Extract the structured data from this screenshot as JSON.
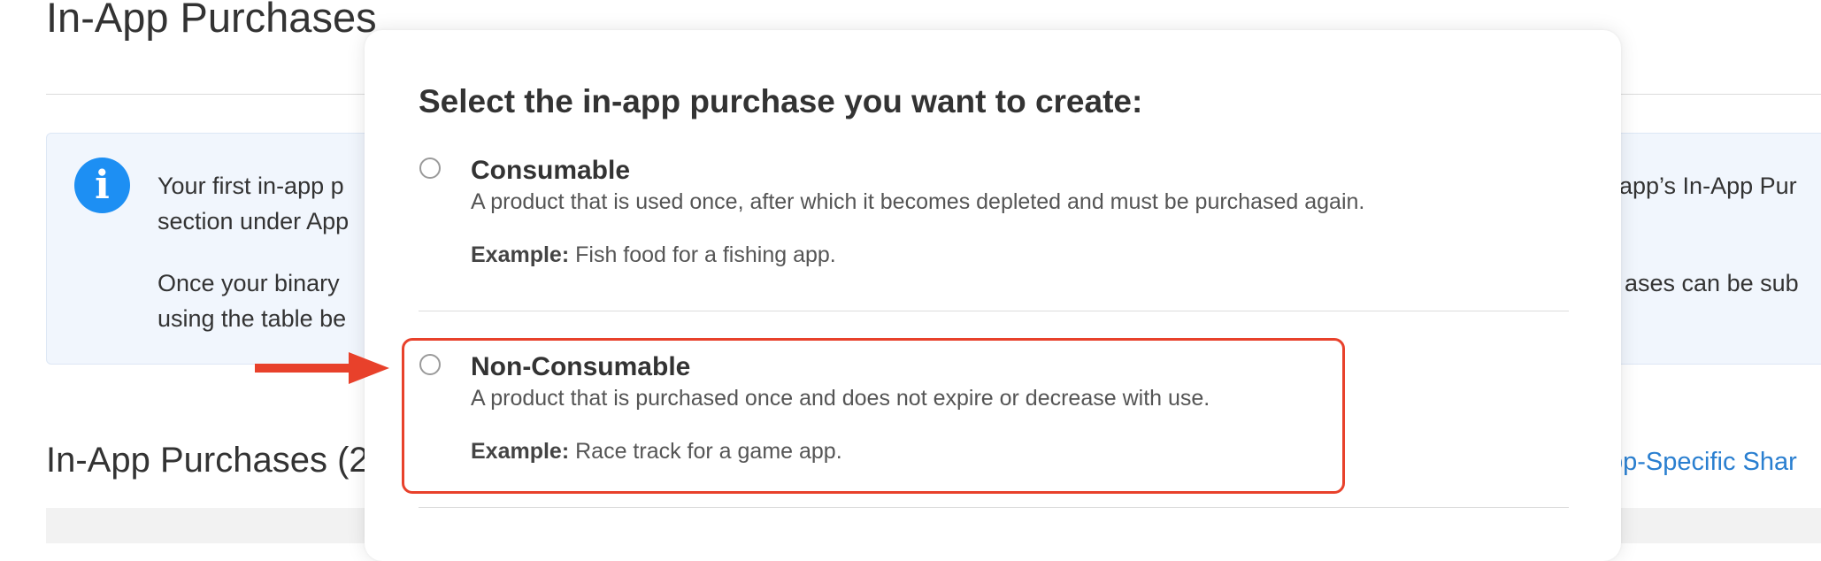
{
  "page": {
    "title": "In-App Purchases"
  },
  "info": {
    "icon": "info-icon",
    "line1_left": "Your first in-app p",
    "line1_right": "app’s In-App Pur",
    "line2_left": "section under App",
    "line3_left": "Once your binary",
    "line3_right": "ases can be sub",
    "line4_left": "using the table be"
  },
  "section": {
    "title": "In-App Purchases (2",
    "link": "pp-Specific Shar"
  },
  "modal": {
    "title": "Select the in-app purchase you want to create:",
    "options": [
      {
        "title": "Consumable",
        "description": "A product that is used once, after which it becomes depleted and must be purchased again.",
        "example_label": "Example:",
        "example_text": " Fish food for a fishing app.",
        "selected": false
      },
      {
        "title": "Non-Consumable",
        "description": "A product that is purchased once and does not expire or decrease with use.",
        "example_label": "Example:",
        "example_text": " Race track for a game app.",
        "selected": false
      }
    ]
  },
  "annotation": {
    "color": "#e8412b"
  }
}
